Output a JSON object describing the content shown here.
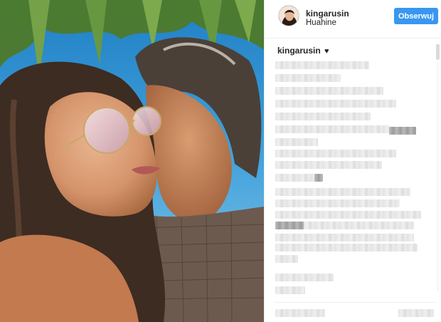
{
  "post": {
    "username": "kingarusin",
    "location": "Huahine",
    "follow_label": "Obserwuj",
    "caption_name": "kingarusin",
    "caption_heart": "♥"
  },
  "icons": {
    "heart": "heart-icon",
    "avatar": "profile-avatar"
  },
  "colors": {
    "follow_button": "#3897f0",
    "text": "#262626"
  }
}
